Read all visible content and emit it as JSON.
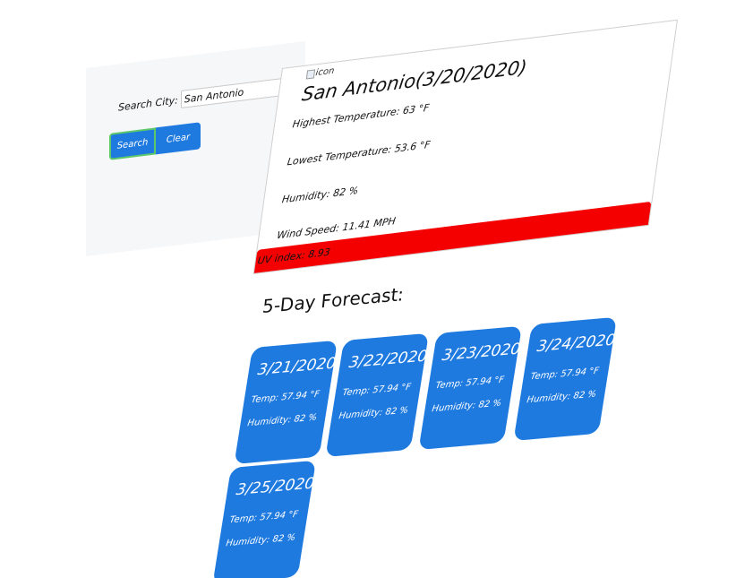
{
  "search": {
    "label": "Search City:",
    "value": "San Antonio",
    "search_button": "Search",
    "clear_button": "Clear"
  },
  "current": {
    "icon_alt": "icon",
    "title": "San Antonio(3/20/2020)",
    "high": "Highest Temperature: 63 °F",
    "low": "Lowest Temperature: 53.6 °F",
    "humidity": "Humidity: 82 %",
    "wind": "Wind Speed: 11.41 MPH",
    "uv": "UV index: 8.93",
    "uv_color": "#f40000"
  },
  "forecast": {
    "title": "5-Day Forecast:",
    "days": [
      {
        "date": "3/21/2020",
        "temp": "Temp: 57.94 °F",
        "humidity": "Humidity: 82 %"
      },
      {
        "date": "3/22/2020",
        "temp": "Temp: 57.94 °F",
        "humidity": "Humidity: 82 %"
      },
      {
        "date": "3/23/2020",
        "temp": "Temp: 57.94 °F",
        "humidity": "Humidity: 82 %"
      },
      {
        "date": "3/24/2020",
        "temp": "Temp: 57.94 °F",
        "humidity": "Humidity: 82 %"
      },
      {
        "date": "3/25/2020",
        "temp": "Temp: 57.94 °F",
        "humidity": "Humidity: 82 %"
      }
    ],
    "card_color": "#1f7ae0"
  }
}
